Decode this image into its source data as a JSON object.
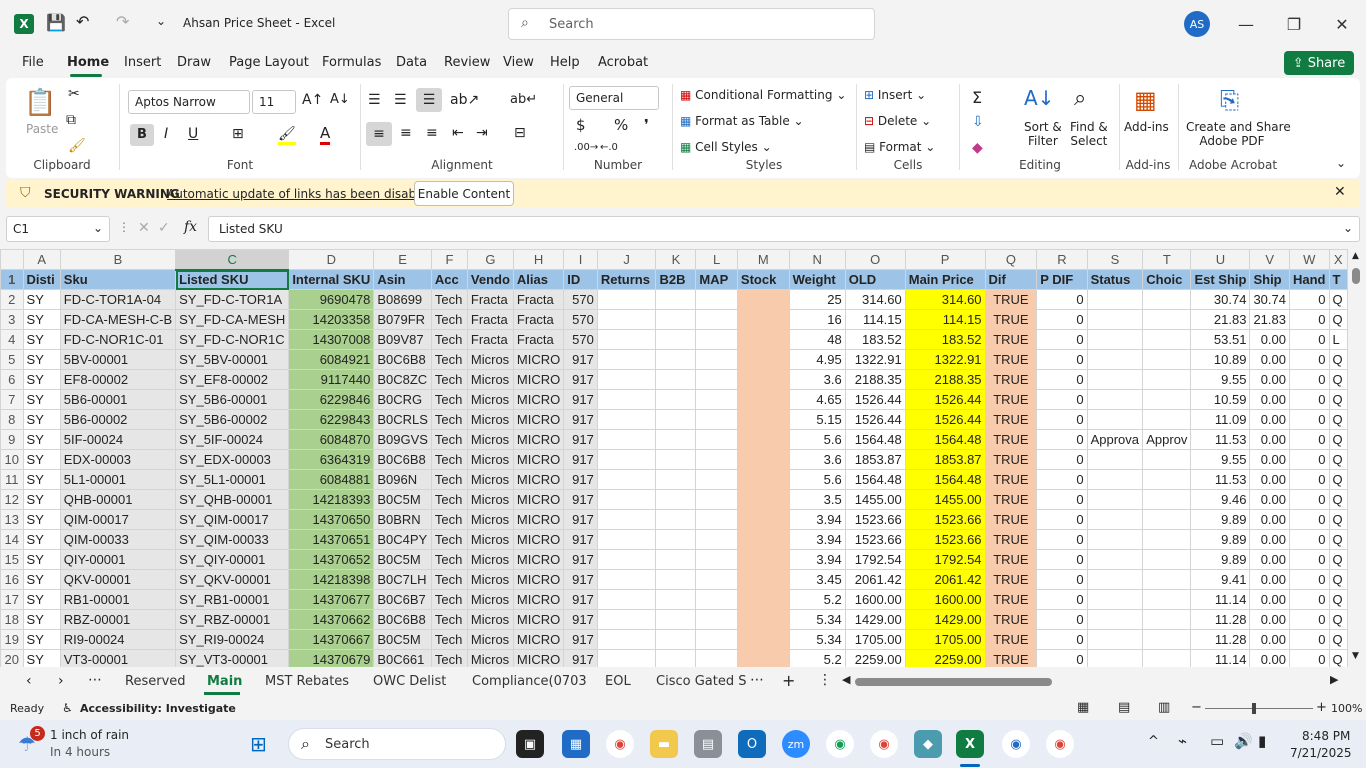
{
  "window": {
    "title": "Ahsan Price Sheet  -  Excel",
    "search_placeholder": "Search",
    "avatar_initials": "AS"
  },
  "menu": {
    "items": [
      "File",
      "Home",
      "Insert",
      "Draw",
      "Page Layout",
      "Formulas",
      "Data",
      "Review",
      "View",
      "Help",
      "Acrobat"
    ],
    "active": "Home",
    "share_label": "Share"
  },
  "ribbon": {
    "clipboard": {
      "paste": "Paste",
      "label": "Clipboard"
    },
    "font": {
      "name": "Aptos Narrow",
      "size": "11",
      "label": "Font"
    },
    "alignment": {
      "label": "Alignment"
    },
    "number": {
      "format": "General",
      "label": "Number"
    },
    "styles": {
      "conditional": "Conditional Formatting",
      "table": "Format as Table",
      "cell": "Cell Styles",
      "label": "Styles"
    },
    "cells": {
      "insert": "Insert",
      "delete": "Delete",
      "format": "Format",
      "label": "Cells"
    },
    "editing": {
      "sort1": "Sort &",
      "sort2": "Filter",
      "find1": "Find &",
      "find2": "Select",
      "label": "Editing"
    },
    "addins": {
      "btn": "Add-ins",
      "label": "Add-ins"
    },
    "acrobat": {
      "btn1": "Create and Share",
      "btn2": "Adobe PDF",
      "label": "Adobe Acrobat"
    }
  },
  "security": {
    "label": "SECURITY WARNING",
    "message": "Automatic update of links has been disabled",
    "button": "Enable Content"
  },
  "formula": {
    "namebox": "C1",
    "fx": "fx",
    "value": "Listed SKU"
  },
  "sheet": {
    "columns": [
      "A",
      "B",
      "C",
      "D",
      "E",
      "F",
      "G",
      "H",
      "I",
      "J",
      "K",
      "L",
      "M",
      "N",
      "O",
      "P",
      "Q",
      "R",
      "S",
      "T",
      "U",
      "V",
      "W",
      "X"
    ],
    "header": [
      "Disti",
      "Sku",
      "Listed SKU",
      "Internal SKU",
      "Asin",
      "Acc",
      "Vendo",
      "Alias",
      "ID",
      "Returns",
      "B2B",
      "MAP",
      "Stock",
      "Weight",
      "OLD",
      "Main Price",
      "Dif",
      "P DIF",
      "Status",
      "Choic",
      "Est Ship",
      "Ship",
      "Hand",
      "T"
    ],
    "rows": [
      [
        "SY",
        "FD-C-TOR1A-04",
        "SY_FD-C-TOR1A",
        "9690478",
        "B08699",
        "Tech",
        "Fracta",
        "Fracta",
        "570",
        "",
        "",
        "",
        "",
        "25",
        "314.60",
        "314.60",
        "TRUE",
        "0",
        "",
        "",
        "30.74",
        "30.74",
        "0",
        "Q"
      ],
      [
        "SY",
        "FD-CA-MESH-C-B",
        "SY_FD-CA-MESH",
        "14203358",
        "B079FR",
        "Tech",
        "Fracta",
        "Fracta",
        "570",
        "",
        "",
        "",
        "",
        "16",
        "114.15",
        "114.15",
        "TRUE",
        "0",
        "",
        "",
        "21.83",
        "21.83",
        "0",
        "Q"
      ],
      [
        "SY",
        "FD-C-NOR1C-01",
        "SY_FD-C-NOR1C",
        "14307008",
        "B09V87",
        "Tech",
        "Fracta",
        "Fracta",
        "570",
        "",
        "",
        "",
        "",
        "48",
        "183.52",
        "183.52",
        "TRUE",
        "0",
        "",
        "",
        "53.51",
        "0.00",
        "0",
        "L"
      ],
      [
        "SY",
        "5BV-00001",
        "SY_5BV-00001",
        "6084921",
        "B0C6B8",
        "Tech",
        "Micros",
        "MICRO",
        "917",
        "",
        "",
        "",
        "",
        "4.95",
        "1322.91",
        "1322.91",
        "TRUE",
        "0",
        "",
        "",
        "10.89",
        "0.00",
        "0",
        "Q"
      ],
      [
        "SY",
        "EF8-00002",
        "SY_EF8-00002",
        "9117440",
        "B0C8ZC",
        "Tech",
        "Micros",
        "MICRO",
        "917",
        "",
        "",
        "",
        "",
        "3.6",
        "2188.35",
        "2188.35",
        "TRUE",
        "0",
        "",
        "",
        "9.55",
        "0.00",
        "0",
        "Q"
      ],
      [
        "SY",
        "5B6-00001",
        "SY_5B6-00001",
        "6229846",
        "B0CRG",
        "Tech",
        "Micros",
        "MICRO",
        "917",
        "",
        "",
        "",
        "",
        "4.65",
        "1526.44",
        "1526.44",
        "TRUE",
        "0",
        "",
        "",
        "10.59",
        "0.00",
        "0",
        "Q"
      ],
      [
        "SY",
        "5B6-00002",
        "SY_5B6-00002",
        "6229843",
        "B0CRLS",
        "Tech",
        "Micros",
        "MICRO",
        "917",
        "",
        "",
        "",
        "",
        "5.15",
        "1526.44",
        "1526.44",
        "TRUE",
        "0",
        "",
        "",
        "11.09",
        "0.00",
        "0",
        "Q"
      ],
      [
        "SY",
        "5IF-00024",
        "SY_5IF-00024",
        "6084870",
        "B09GVS",
        "Tech",
        "Micros",
        "MICRO",
        "917",
        "",
        "",
        "",
        "",
        "5.6",
        "1564.48",
        "1564.48",
        "TRUE",
        "0",
        "Approva",
        "Approv",
        "11.53",
        "0.00",
        "0",
        "Q"
      ],
      [
        "SY",
        "EDX-00003",
        "SY_EDX-00003",
        "6364319",
        "B0C6B8",
        "Tech",
        "Micros",
        "MICRO",
        "917",
        "",
        "",
        "",
        "",
        "3.6",
        "1853.87",
        "1853.87",
        "TRUE",
        "0",
        "",
        "",
        "9.55",
        "0.00",
        "0",
        "Q"
      ],
      [
        "SY",
        "5L1-00001",
        "SY_5L1-00001",
        "6084881",
        "B096N",
        "Tech",
        "Micros",
        "MICRO",
        "917",
        "",
        "",
        "",
        "",
        "5.6",
        "1564.48",
        "1564.48",
        "TRUE",
        "0",
        "",
        "",
        "11.53",
        "0.00",
        "0",
        "Q"
      ],
      [
        "SY",
        "QHB-00001",
        "SY_QHB-00001",
        "14218393",
        "B0C5M",
        "Tech",
        "Micros",
        "MICRO",
        "917",
        "",
        "",
        "",
        "",
        "3.5",
        "1455.00",
        "1455.00",
        "TRUE",
        "0",
        "",
        "",
        "9.46",
        "0.00",
        "0",
        "Q"
      ],
      [
        "SY",
        "QIM-00017",
        "SY_QIM-00017",
        "14370650",
        "B0BRN",
        "Tech",
        "Micros",
        "MICRO",
        "917",
        "",
        "",
        "",
        "",
        "3.94",
        "1523.66",
        "1523.66",
        "TRUE",
        "0",
        "",
        "",
        "9.89",
        "0.00",
        "0",
        "Q"
      ],
      [
        "SY",
        "QIM-00033",
        "SY_QIM-00033",
        "14370651",
        "B0C4PY",
        "Tech",
        "Micros",
        "MICRO",
        "917",
        "",
        "",
        "",
        "",
        "3.94",
        "1523.66",
        "1523.66",
        "TRUE",
        "0",
        "",
        "",
        "9.89",
        "0.00",
        "0",
        "Q"
      ],
      [
        "SY",
        "QIY-00001",
        "SY_QIY-00001",
        "14370652",
        "B0C5M",
        "Tech",
        "Micros",
        "MICRO",
        "917",
        "",
        "",
        "",
        "",
        "3.94",
        "1792.54",
        "1792.54",
        "TRUE",
        "0",
        "",
        "",
        "9.89",
        "0.00",
        "0",
        "Q"
      ],
      [
        "SY",
        "QKV-00001",
        "SY_QKV-00001",
        "14218398",
        "B0C7LH",
        "Tech",
        "Micros",
        "MICRO",
        "917",
        "",
        "",
        "",
        "",
        "3.45",
        "2061.42",
        "2061.42",
        "TRUE",
        "0",
        "",
        "",
        "9.41",
        "0.00",
        "0",
        "Q"
      ],
      [
        "SY",
        "RB1-00001",
        "SY_RB1-00001",
        "14370677",
        "B0C6B7",
        "Tech",
        "Micros",
        "MICRO",
        "917",
        "",
        "",
        "",
        "",
        "5.2",
        "1600.00",
        "1600.00",
        "TRUE",
        "0",
        "",
        "",
        "11.14",
        "0.00",
        "0",
        "Q"
      ],
      [
        "SY",
        "RBZ-00001",
        "SY_RBZ-00001",
        "14370662",
        "B0C6B8",
        "Tech",
        "Micros",
        "MICRO",
        "917",
        "",
        "",
        "",
        "",
        "5.34",
        "1429.00",
        "1429.00",
        "TRUE",
        "0",
        "",
        "",
        "11.28",
        "0.00",
        "0",
        "Q"
      ],
      [
        "SY",
        "RI9-00024",
        "SY_RI9-00024",
        "14370667",
        "B0C5M",
        "Tech",
        "Micros",
        "MICRO",
        "917",
        "",
        "",
        "",
        "",
        "5.34",
        "1705.00",
        "1705.00",
        "TRUE",
        "0",
        "",
        "",
        "11.28",
        "0.00",
        "0",
        "Q"
      ],
      [
        "SY",
        "VT3-00001",
        "SY_VT3-00001",
        "14370679",
        "B0C661",
        "Tech",
        "Micros",
        "MICRO",
        "917",
        "",
        "",
        "",
        "",
        "5.2",
        "2259.00",
        "2259.00",
        "TRUE",
        "0",
        "",
        "",
        "11.14",
        "0.00",
        "0",
        "Q"
      ]
    ]
  },
  "tabs": {
    "items": [
      "Reserved",
      "Main",
      "MST Rebates",
      "OWC Delist",
      "Compliance(0703",
      "EOL",
      "Cisco Gated S"
    ],
    "active": "Main"
  },
  "status": {
    "ready": "Ready",
    "accessibility": "Accessibility: Investigate",
    "zoom": "100%"
  },
  "taskbar": {
    "weather_title": "1 inch of rain",
    "weather_sub": "In 4 hours",
    "weather_badge": "5",
    "search": "Search",
    "time": "8:48 PM",
    "date": "7/21/2025"
  }
}
